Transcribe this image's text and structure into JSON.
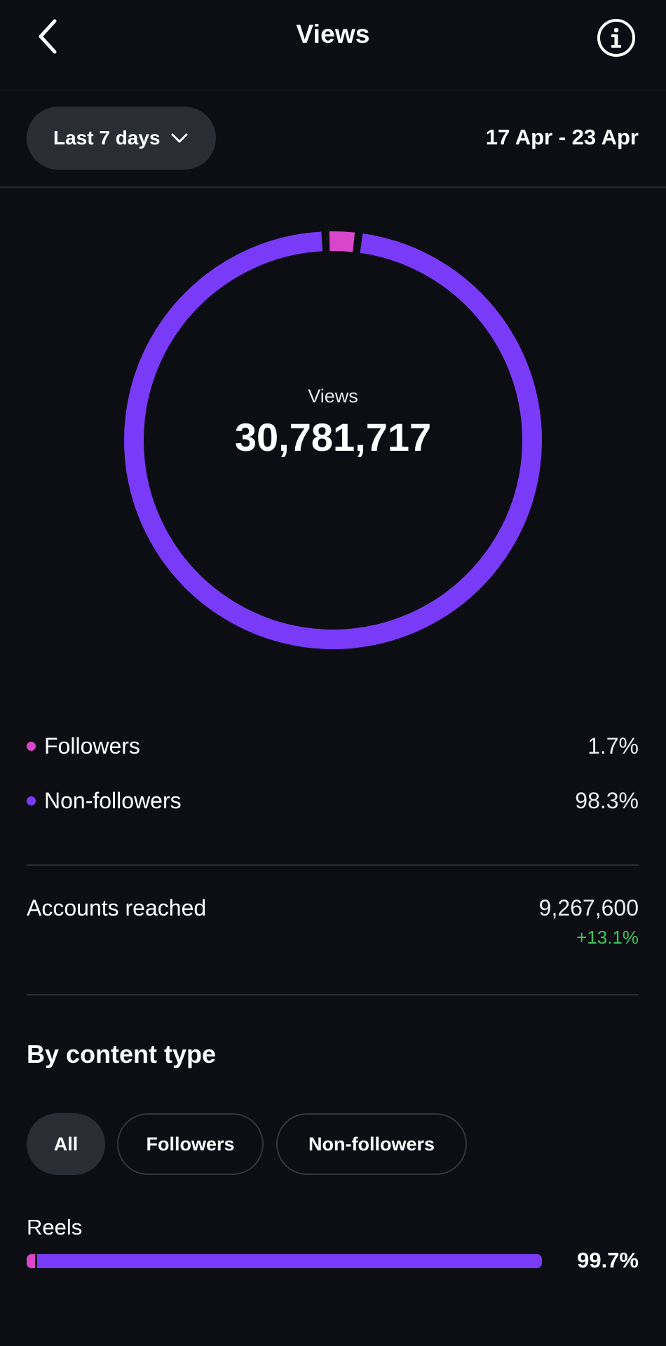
{
  "header": {
    "title": "Views",
    "back_icon": "chevron-left-icon",
    "info_icon": "info-circle-icon"
  },
  "filters": {
    "range_label": "Last 7 days",
    "range_icon": "chevron-down-icon",
    "date_range": "17 Apr - 23 Apr"
  },
  "summary": {
    "label": "Views",
    "value": "30,781,717"
  },
  "chart_data": {
    "type": "pie",
    "style": "donut",
    "categories": [
      "Followers",
      "Non-followers"
    ],
    "values": [
      1.7,
      98.3
    ],
    "unit": "%",
    "colors": [
      "#d946c9",
      "#7a3bf8"
    ],
    "center_label": "Views",
    "center_value": 30781717
  },
  "breakdown": [
    {
      "label": "Followers",
      "value": "1.7%",
      "color": "#d946c9"
    },
    {
      "label": "Non-followers",
      "value": "98.3%",
      "color": "#7a3bf8"
    }
  ],
  "accounts_reached": {
    "label": "Accounts reached",
    "value": "9,267,600",
    "change": "+13.1%",
    "change_color": "#3ec55b"
  },
  "content_type": {
    "title": "By content type",
    "chips": [
      {
        "label": "All",
        "active": true
      },
      {
        "label": "Followers",
        "active": false
      },
      {
        "label": "Non-followers",
        "active": false
      }
    ],
    "rows": [
      {
        "label": "Reels",
        "value": "99.7%",
        "followers_share": 1.7,
        "nonfollowers_share": 98.3
      }
    ]
  },
  "colors": {
    "background": "#0c0e14",
    "followers": "#d946c9",
    "non_followers": "#7a3bf8",
    "positive": "#3ec55b"
  }
}
